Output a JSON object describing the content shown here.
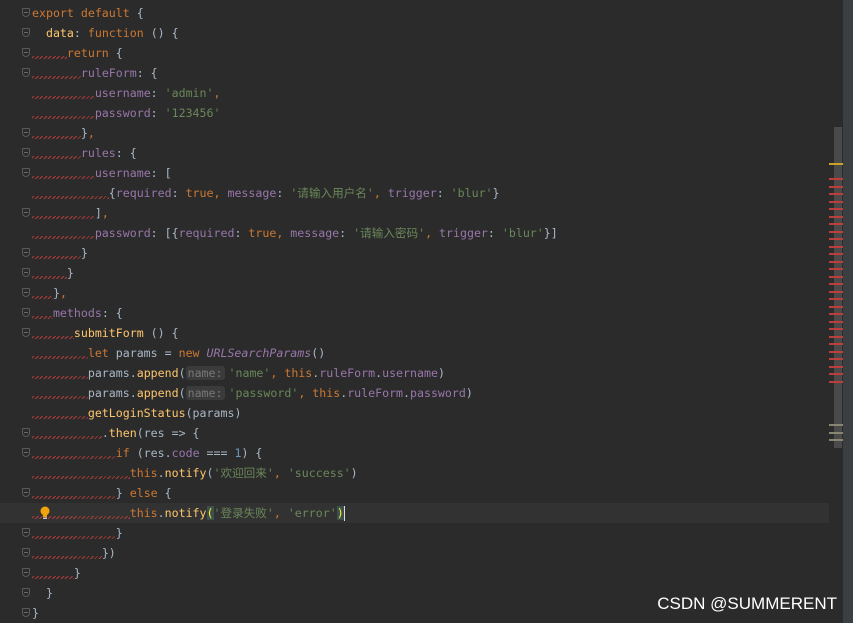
{
  "colors": {
    "background": "#2b2b2b",
    "keyword": "#cc7832",
    "property": "#9876aa",
    "string": "#6a8759",
    "text": "#a9b7c6",
    "function": "#ffc66d",
    "number": "#6897bb",
    "error_mark": "#bc3f3c",
    "warning_mark": "#c9a227"
  },
  "editor": {
    "current_line": 25,
    "lines": [
      {
        "indent": "",
        "fold": true,
        "squiggle": false,
        "tokens": [
          [
            "kw",
            "export default "
          ],
          [
            "",
            "{"
          ]
        ]
      },
      {
        "indent": "  ",
        "fold": true,
        "squiggle": false,
        "tokens": [
          [
            "fn",
            "data"
          ],
          [
            "",
            ": "
          ],
          [
            "kw",
            "function "
          ],
          [
            "",
            "() {"
          ]
        ]
      },
      {
        "indent": "     ",
        "fold": true,
        "squiggle": true,
        "tokens": [
          [
            "kw",
            "return "
          ],
          [
            "",
            "{"
          ]
        ]
      },
      {
        "indent": "       ",
        "fold": true,
        "squiggle": true,
        "tokens": [
          [
            "prop",
            "ruleForm"
          ],
          [
            "",
            ": {"
          ]
        ]
      },
      {
        "indent": "         ",
        "fold": false,
        "squiggle": true,
        "tokens": [
          [
            "prop",
            "username"
          ],
          [
            "",
            ": "
          ],
          [
            "str",
            "'admin'"
          ],
          [
            "kw",
            ","
          ]
        ]
      },
      {
        "indent": "         ",
        "fold": false,
        "squiggle": true,
        "tokens": [
          [
            "prop",
            "password"
          ],
          [
            "",
            ": "
          ],
          [
            "str",
            "'123456'"
          ]
        ]
      },
      {
        "indent": "       ",
        "fold": true,
        "squiggle": true,
        "tokens": [
          [
            "",
            "}"
          ],
          [
            "kw",
            ","
          ]
        ]
      },
      {
        "indent": "       ",
        "fold": true,
        "squiggle": true,
        "tokens": [
          [
            "prop",
            "rules"
          ],
          [
            "",
            ": {"
          ]
        ]
      },
      {
        "indent": "         ",
        "fold": true,
        "squiggle": true,
        "tokens": [
          [
            "prop",
            "username"
          ],
          [
            "",
            ": ["
          ]
        ]
      },
      {
        "indent": "           ",
        "fold": false,
        "squiggle": true,
        "tokens": [
          [
            "",
            "{"
          ],
          [
            "prop",
            "required"
          ],
          [
            "",
            ": "
          ],
          [
            "kw",
            "true"
          ],
          [
            "kw",
            ", "
          ],
          [
            "prop",
            "message"
          ],
          [
            "",
            ": "
          ],
          [
            "str",
            "'请输入用户名'"
          ],
          [
            "kw",
            ", "
          ],
          [
            "prop",
            "trigger"
          ],
          [
            "",
            ": "
          ],
          [
            "str",
            "'blur'"
          ],
          [
            "",
            "}"
          ]
        ]
      },
      {
        "indent": "         ",
        "fold": true,
        "squiggle": true,
        "tokens": [
          [
            "",
            "]"
          ],
          [
            "kw",
            ","
          ]
        ]
      },
      {
        "indent": "         ",
        "fold": false,
        "squiggle": true,
        "tokens": [
          [
            "prop",
            "password"
          ],
          [
            "",
            ": [{"
          ],
          [
            "prop",
            "required"
          ],
          [
            "",
            ": "
          ],
          [
            "kw",
            "true"
          ],
          [
            "kw",
            ", "
          ],
          [
            "prop",
            "message"
          ],
          [
            "",
            ": "
          ],
          [
            "str",
            "'请输入密码'"
          ],
          [
            "kw",
            ", "
          ],
          [
            "prop",
            "trigger"
          ],
          [
            "",
            ": "
          ],
          [
            "str",
            "'blur'"
          ],
          [
            "",
            "}]"
          ]
        ]
      },
      {
        "indent": "       ",
        "fold": true,
        "squiggle": true,
        "tokens": [
          [
            "",
            "}"
          ]
        ]
      },
      {
        "indent": "     ",
        "fold": true,
        "squiggle": true,
        "tokens": [
          [
            "",
            "}"
          ]
        ]
      },
      {
        "indent": "   ",
        "fold": true,
        "squiggle": true,
        "tokens": [
          [
            "",
            "}"
          ],
          [
            "kw",
            ","
          ]
        ]
      },
      {
        "indent": "   ",
        "fold": true,
        "squiggle": true,
        "tokens": [
          [
            "prop",
            "methods"
          ],
          [
            "",
            ": {"
          ]
        ]
      },
      {
        "indent": "      ",
        "fold": true,
        "squiggle": true,
        "tokens": [
          [
            "fn",
            "submitForm "
          ],
          [
            "",
            "() {"
          ]
        ]
      },
      {
        "indent": "        ",
        "fold": false,
        "squiggle": true,
        "tokens": [
          [
            "kw",
            "let "
          ],
          [
            "",
            "params = "
          ],
          [
            "kw",
            "new "
          ],
          [
            "cls",
            "URLSearchParams"
          ],
          [
            "",
            "()"
          ]
        ]
      },
      {
        "indent": "        ",
        "fold": false,
        "squiggle": true,
        "tokens": [
          [
            "",
            "params."
          ],
          [
            "fn",
            "append"
          ],
          [
            "",
            "("
          ],
          [
            "hint",
            "name:"
          ],
          [
            "str",
            "'name'"
          ],
          [
            "kw",
            ", this"
          ],
          [
            "",
            "."
          ],
          [
            "prop",
            "ruleForm"
          ],
          [
            "",
            "."
          ],
          [
            "prop",
            "username"
          ],
          [
            "",
            ")"
          ]
        ]
      },
      {
        "indent": "        ",
        "fold": false,
        "squiggle": true,
        "tokens": [
          [
            "",
            "params."
          ],
          [
            "fn",
            "append"
          ],
          [
            "",
            "("
          ],
          [
            "hint",
            "name:"
          ],
          [
            "str",
            "'password'"
          ],
          [
            "kw",
            ", this"
          ],
          [
            "",
            "."
          ],
          [
            "prop",
            "ruleForm"
          ],
          [
            "",
            "."
          ],
          [
            "prop",
            "password"
          ],
          [
            "",
            ")"
          ]
        ]
      },
      {
        "indent": "        ",
        "fold": false,
        "squiggle": true,
        "tokens": [
          [
            "fn",
            "getLoginStatus"
          ],
          [
            "",
            "(params)"
          ]
        ]
      },
      {
        "indent": "          ",
        "fold": true,
        "squiggle": true,
        "tokens": [
          [
            "",
            "."
          ],
          [
            "fn",
            "then"
          ],
          [
            "",
            "(res => {"
          ]
        ]
      },
      {
        "indent": "            ",
        "fold": true,
        "squiggle": true,
        "tokens": [
          [
            "kw",
            "if "
          ],
          [
            "",
            "(res."
          ],
          [
            "prop",
            "code"
          ],
          [
            "",
            " === "
          ],
          [
            "num",
            "1"
          ],
          [
            "",
            ") {"
          ]
        ]
      },
      {
        "indent": "              ",
        "fold": false,
        "squiggle": true,
        "tokens": [
          [
            "kw",
            "this"
          ],
          [
            "",
            "."
          ],
          [
            "fn",
            "notify"
          ],
          [
            "",
            "("
          ],
          [
            "str",
            "'欢迎回来'"
          ],
          [
            "kw",
            ", "
          ],
          [
            "str",
            "'success'"
          ],
          [
            "",
            ")"
          ]
        ]
      },
      {
        "indent": "            ",
        "fold": true,
        "squiggle": true,
        "tokens": [
          [
            "",
            "} "
          ],
          [
            "kw",
            "else "
          ],
          [
            "",
            "{"
          ]
        ]
      },
      {
        "indent": "              ",
        "fold": false,
        "squiggle": true,
        "bulb": true,
        "tokens": [
          [
            "kw",
            "this"
          ],
          [
            "",
            "."
          ],
          [
            "fn",
            "notify"
          ],
          [
            "brace-match",
            "("
          ],
          [
            "str",
            "'登录失败'"
          ],
          [
            "kw",
            ", "
          ],
          [
            "str",
            "'error'"
          ],
          [
            "brace-match",
            ")"
          ],
          [
            "caret",
            ""
          ]
        ]
      },
      {
        "indent": "            ",
        "fold": true,
        "squiggle": true,
        "tokens": [
          [
            "",
            "}"
          ]
        ]
      },
      {
        "indent": "          ",
        "fold": true,
        "squiggle": true,
        "tokens": [
          [
            "",
            "})"
          ]
        ]
      },
      {
        "indent": "      ",
        "fold": true,
        "squiggle": true,
        "tokens": [
          [
            "",
            "}"
          ]
        ]
      },
      {
        "indent": "  ",
        "fold": true,
        "squiggle": false,
        "tokens": [
          [
            "",
            "}"
          ]
        ]
      },
      {
        "indent": "",
        "fold": true,
        "squiggle": false,
        "tokens": [
          [
            "",
            "}"
          ]
        ]
      }
    ]
  },
  "scrollbar": {
    "warning_markers": 1,
    "error_markers": 28,
    "info_markers": 3
  },
  "watermark": "CSDN @SUMMERENT"
}
